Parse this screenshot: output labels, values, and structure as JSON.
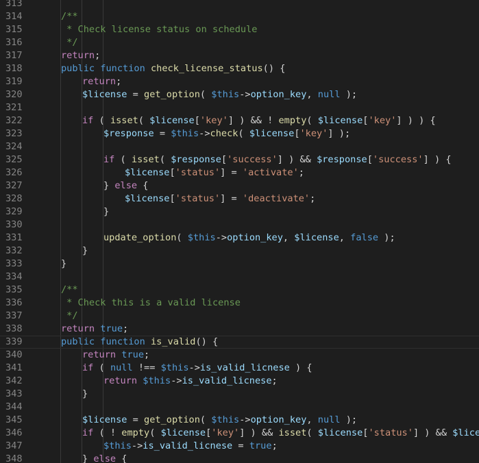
{
  "editor": {
    "language": "php",
    "colors": {
      "background": "#1e1e1e",
      "line_number": "#858585",
      "keyword": "#569cd6",
      "control": "#c586c0",
      "function": "#dcdcaa",
      "variable": "#9cdcfe",
      "string": "#ce9178",
      "comment": "#6a9955",
      "plain": "#d4d4d4"
    },
    "current_line": 339,
    "lines": [
      {
        "n": "313",
        "indent": 0,
        "tokens": []
      },
      {
        "n": "314",
        "indent": 1,
        "tokens": [
          [
            "cmt",
            "/**"
          ]
        ]
      },
      {
        "n": "315",
        "indent": 1,
        "tokens": [
          [
            "cmt",
            " * Check license status on schedule"
          ]
        ]
      },
      {
        "n": "316",
        "indent": 1,
        "tokens": [
          [
            "cmt",
            " */"
          ]
        ]
      },
      {
        "n": "317",
        "indent": 1,
        "tokens": [
          [
            "ctl",
            "return"
          ],
          [
            "pl",
            ";"
          ]
        ]
      },
      {
        "n": "318",
        "indent": 1,
        "tokens": [
          [
            "kw",
            "public"
          ],
          [
            "pl",
            " "
          ],
          [
            "kw",
            "function"
          ],
          [
            "pl",
            " "
          ],
          [
            "fn",
            "check_license_status"
          ],
          [
            "pl",
            "() {"
          ]
        ]
      },
      {
        "n": "319",
        "indent": 2,
        "tokens": [
          [
            "ctl",
            "return"
          ],
          [
            "pl",
            ";"
          ]
        ]
      },
      {
        "n": "320",
        "indent": 2,
        "tokens": [
          [
            "var",
            "$license"
          ],
          [
            "pl",
            " = "
          ],
          [
            "fn",
            "get_option"
          ],
          [
            "pl",
            "( "
          ],
          [
            "kw",
            "$this"
          ],
          [
            "pl",
            "->"
          ],
          [
            "var",
            "option_key"
          ],
          [
            "pl",
            ", "
          ],
          [
            "kw",
            "null"
          ],
          [
            "pl",
            " );"
          ]
        ]
      },
      {
        "n": "321",
        "indent": 0,
        "tokens": []
      },
      {
        "n": "322",
        "indent": 2,
        "tokens": [
          [
            "ctl",
            "if"
          ],
          [
            "pl",
            " ( "
          ],
          [
            "fn",
            "isset"
          ],
          [
            "pl",
            "( "
          ],
          [
            "var",
            "$license"
          ],
          [
            "pl",
            "["
          ],
          [
            "str",
            "'key'"
          ],
          [
            "pl",
            "] ) && ! "
          ],
          [
            "fn",
            "empty"
          ],
          [
            "pl",
            "( "
          ],
          [
            "var",
            "$license"
          ],
          [
            "pl",
            "["
          ],
          [
            "str",
            "'key'"
          ],
          [
            "pl",
            "] ) ) {"
          ]
        ]
      },
      {
        "n": "323",
        "indent": 3,
        "tokens": [
          [
            "var",
            "$response"
          ],
          [
            "pl",
            " = "
          ],
          [
            "kw",
            "$this"
          ],
          [
            "pl",
            "->"
          ],
          [
            "fn",
            "check"
          ],
          [
            "pl",
            "( "
          ],
          [
            "var",
            "$license"
          ],
          [
            "pl",
            "["
          ],
          [
            "str",
            "'key'"
          ],
          [
            "pl",
            "] );"
          ]
        ]
      },
      {
        "n": "324",
        "indent": 0,
        "tokens": []
      },
      {
        "n": "325",
        "indent": 3,
        "tokens": [
          [
            "ctl",
            "if"
          ],
          [
            "pl",
            " ( "
          ],
          [
            "fn",
            "isset"
          ],
          [
            "pl",
            "( "
          ],
          [
            "var",
            "$response"
          ],
          [
            "pl",
            "["
          ],
          [
            "str",
            "'success'"
          ],
          [
            "pl",
            "] ) && "
          ],
          [
            "var",
            "$response"
          ],
          [
            "pl",
            "["
          ],
          [
            "str",
            "'success'"
          ],
          [
            "pl",
            "] ) {"
          ]
        ]
      },
      {
        "n": "326",
        "indent": 4,
        "tokens": [
          [
            "var",
            "$license"
          ],
          [
            "pl",
            "["
          ],
          [
            "str",
            "'status'"
          ],
          [
            "pl",
            "] = "
          ],
          [
            "str",
            "'activate'"
          ],
          [
            "pl",
            ";"
          ]
        ]
      },
      {
        "n": "327",
        "indent": 3,
        "tokens": [
          [
            "pl",
            "} "
          ],
          [
            "ctl",
            "else"
          ],
          [
            "pl",
            " {"
          ]
        ]
      },
      {
        "n": "328",
        "indent": 4,
        "tokens": [
          [
            "var",
            "$license"
          ],
          [
            "pl",
            "["
          ],
          [
            "str",
            "'status'"
          ],
          [
            "pl",
            "] = "
          ],
          [
            "str",
            "'deactivate'"
          ],
          [
            "pl",
            ";"
          ]
        ]
      },
      {
        "n": "329",
        "indent": 3,
        "tokens": [
          [
            "pl",
            "}"
          ]
        ]
      },
      {
        "n": "330",
        "indent": 0,
        "tokens": []
      },
      {
        "n": "331",
        "indent": 3,
        "tokens": [
          [
            "fn",
            "update_option"
          ],
          [
            "pl",
            "( "
          ],
          [
            "kw",
            "$this"
          ],
          [
            "pl",
            "->"
          ],
          [
            "var",
            "option_key"
          ],
          [
            "pl",
            ", "
          ],
          [
            "var",
            "$license"
          ],
          [
            "pl",
            ", "
          ],
          [
            "kw",
            "false"
          ],
          [
            "pl",
            " );"
          ]
        ]
      },
      {
        "n": "332",
        "indent": 2,
        "tokens": [
          [
            "pl",
            "}"
          ]
        ]
      },
      {
        "n": "333",
        "indent": 1,
        "tokens": [
          [
            "pl",
            "}"
          ]
        ]
      },
      {
        "n": "334",
        "indent": 0,
        "tokens": []
      },
      {
        "n": "335",
        "indent": 1,
        "tokens": [
          [
            "cmt",
            "/**"
          ]
        ]
      },
      {
        "n": "336",
        "indent": 1,
        "tokens": [
          [
            "cmt",
            " * Check this is a valid license"
          ]
        ]
      },
      {
        "n": "337",
        "indent": 1,
        "tokens": [
          [
            "cmt",
            " */"
          ]
        ]
      },
      {
        "n": "338",
        "indent": 1,
        "tokens": [
          [
            "ctl",
            "return"
          ],
          [
            "pl",
            " "
          ],
          [
            "kw",
            "true"
          ],
          [
            "pl",
            ";"
          ]
        ]
      },
      {
        "n": "339",
        "indent": 1,
        "tokens": [
          [
            "kw",
            "public"
          ],
          [
            "pl",
            " "
          ],
          [
            "kw",
            "function"
          ],
          [
            "pl",
            " "
          ],
          [
            "fn",
            "is_valid"
          ],
          [
            "pl",
            "() {"
          ]
        ]
      },
      {
        "n": "340",
        "indent": 2,
        "tokens": [
          [
            "ctl",
            "return"
          ],
          [
            "pl",
            " "
          ],
          [
            "kw",
            "true"
          ],
          [
            "pl",
            ";"
          ]
        ]
      },
      {
        "n": "341",
        "indent": 2,
        "tokens": [
          [
            "ctl",
            "if"
          ],
          [
            "pl",
            " ( "
          ],
          [
            "kw",
            "null"
          ],
          [
            "pl",
            " !== "
          ],
          [
            "kw",
            "$this"
          ],
          [
            "pl",
            "->"
          ],
          [
            "var",
            "is_valid_licnese"
          ],
          [
            "pl",
            " ) {"
          ]
        ]
      },
      {
        "n": "342",
        "indent": 3,
        "tokens": [
          [
            "ctl",
            "return"
          ],
          [
            "pl",
            " "
          ],
          [
            "kw",
            "$this"
          ],
          [
            "pl",
            "->"
          ],
          [
            "var",
            "is_valid_licnese"
          ],
          [
            "pl",
            ";"
          ]
        ]
      },
      {
        "n": "343",
        "indent": 2,
        "tokens": [
          [
            "pl",
            "}"
          ]
        ]
      },
      {
        "n": "344",
        "indent": 0,
        "tokens": []
      },
      {
        "n": "345",
        "indent": 2,
        "tokens": [
          [
            "var",
            "$license"
          ],
          [
            "pl",
            " = "
          ],
          [
            "fn",
            "get_option"
          ],
          [
            "pl",
            "( "
          ],
          [
            "kw",
            "$this"
          ],
          [
            "pl",
            "->"
          ],
          [
            "var",
            "option_key"
          ],
          [
            "pl",
            ", "
          ],
          [
            "kw",
            "null"
          ],
          [
            "pl",
            " );"
          ]
        ]
      },
      {
        "n": "346",
        "indent": 2,
        "tokens": [
          [
            "ctl",
            "if"
          ],
          [
            "pl",
            " ( ! "
          ],
          [
            "fn",
            "empty"
          ],
          [
            "pl",
            "( "
          ],
          [
            "var",
            "$license"
          ],
          [
            "pl",
            "["
          ],
          [
            "str",
            "'key'"
          ],
          [
            "pl",
            "] ) && "
          ],
          [
            "fn",
            "isset"
          ],
          [
            "pl",
            "( "
          ],
          [
            "var",
            "$license"
          ],
          [
            "pl",
            "["
          ],
          [
            "str",
            "'status'"
          ],
          [
            "pl",
            "] ) && "
          ],
          [
            "var",
            "$license"
          ],
          [
            "pl",
            "["
          ]
        ]
      },
      {
        "n": "347",
        "indent": 3,
        "tokens": [
          [
            "kw",
            "$this"
          ],
          [
            "pl",
            "->"
          ],
          [
            "var",
            "is_valid_licnese"
          ],
          [
            "pl",
            " = "
          ],
          [
            "kw",
            "true"
          ],
          [
            "pl",
            ";"
          ]
        ]
      },
      {
        "n": "348",
        "indent": 2,
        "tokens": [
          [
            "pl",
            "} "
          ],
          [
            "ctl",
            "else"
          ],
          [
            "pl",
            " {"
          ]
        ]
      }
    ]
  }
}
